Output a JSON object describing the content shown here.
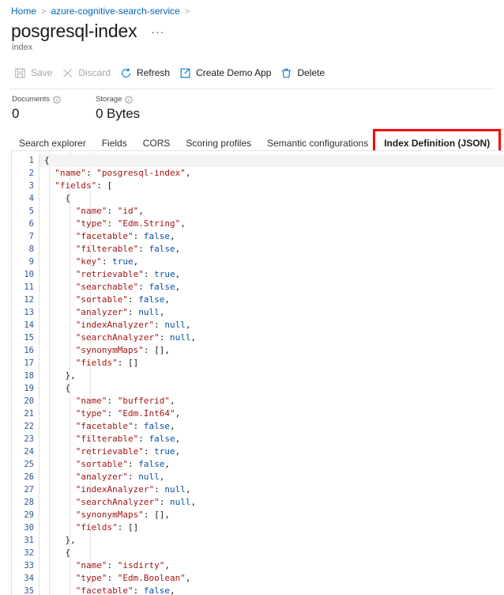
{
  "breadcrumb": {
    "items": [
      {
        "label": "Home",
        "link": true
      },
      {
        "label": "azure-cognitive-search-service",
        "link": true
      }
    ],
    "separator": ">"
  },
  "header": {
    "title": "posgresql-index",
    "ellipsis_label": "···",
    "subtitle": "index"
  },
  "toolbar": {
    "buttons": [
      {
        "label": "Save",
        "icon": "save-icon",
        "disabled": true
      },
      {
        "label": "Discard",
        "icon": "discard-icon",
        "disabled": true
      },
      {
        "label": "Refresh",
        "icon": "refresh-icon",
        "disabled": false
      },
      {
        "label": "Create Demo App",
        "icon": "open-in-new-icon",
        "disabled": false
      },
      {
        "label": "Delete",
        "icon": "trash-icon",
        "disabled": false
      }
    ]
  },
  "metrics": [
    {
      "label": "Documents",
      "value": "0",
      "icon": "info-icon"
    },
    {
      "label": "Storage",
      "value": "0 Bytes",
      "icon": "info-icon"
    }
  ],
  "tabs": {
    "items": [
      {
        "label": "Search explorer",
        "active": false
      },
      {
        "label": "Fields",
        "active": false
      },
      {
        "label": "CORS",
        "active": false
      },
      {
        "label": "Scoring profiles",
        "active": false
      },
      {
        "label": "Semantic configurations",
        "active": false
      },
      {
        "label": "Index Definition (JSON)",
        "active": true
      }
    ],
    "annotation_color": "#ff0000"
  },
  "editor": {
    "language": "json",
    "lines": [
      {
        "n": "1",
        "tokens": [
          {
            "t": "{",
            "c": "p"
          }
        ]
      },
      {
        "n": "2",
        "tokens": [
          {
            "t": "  \"name\"",
            "c": "k"
          },
          {
            "t": ": ",
            "c": "p"
          },
          {
            "t": "\"posgresql-index\"",
            "c": "s"
          },
          {
            "t": ",",
            "c": "p"
          }
        ]
      },
      {
        "n": "3",
        "tokens": [
          {
            "t": "  \"fields\"",
            "c": "k"
          },
          {
            "t": ": [",
            "c": "p"
          }
        ]
      },
      {
        "n": "4",
        "tokens": [
          {
            "t": "    {",
            "c": "p"
          }
        ]
      },
      {
        "n": "5",
        "tokens": [
          {
            "t": "      \"name\"",
            "c": "k"
          },
          {
            "t": ": ",
            "c": "p"
          },
          {
            "t": "\"id\"",
            "c": "s"
          },
          {
            "t": ",",
            "c": "p"
          }
        ]
      },
      {
        "n": "6",
        "tokens": [
          {
            "t": "      \"type\"",
            "c": "k"
          },
          {
            "t": ": ",
            "c": "p"
          },
          {
            "t": "\"Edm.String\"",
            "c": "s"
          },
          {
            "t": ",",
            "c": "p"
          }
        ]
      },
      {
        "n": "7",
        "tokens": [
          {
            "t": "      \"facetable\"",
            "c": "k"
          },
          {
            "t": ": ",
            "c": "p"
          },
          {
            "t": "false",
            "c": "b"
          },
          {
            "t": ",",
            "c": "p"
          }
        ]
      },
      {
        "n": "8",
        "tokens": [
          {
            "t": "      \"filterable\"",
            "c": "k"
          },
          {
            "t": ": ",
            "c": "p"
          },
          {
            "t": "false",
            "c": "b"
          },
          {
            "t": ",",
            "c": "p"
          }
        ]
      },
      {
        "n": "9",
        "tokens": [
          {
            "t": "      \"key\"",
            "c": "k"
          },
          {
            "t": ": ",
            "c": "p"
          },
          {
            "t": "true",
            "c": "b"
          },
          {
            "t": ",",
            "c": "p"
          }
        ]
      },
      {
        "n": "10",
        "tokens": [
          {
            "t": "      \"retrievable\"",
            "c": "k"
          },
          {
            "t": ": ",
            "c": "p"
          },
          {
            "t": "true",
            "c": "b"
          },
          {
            "t": ",",
            "c": "p"
          }
        ]
      },
      {
        "n": "11",
        "tokens": [
          {
            "t": "      \"searchable\"",
            "c": "k"
          },
          {
            "t": ": ",
            "c": "p"
          },
          {
            "t": "false",
            "c": "b"
          },
          {
            "t": ",",
            "c": "p"
          }
        ]
      },
      {
        "n": "12",
        "tokens": [
          {
            "t": "      \"sortable\"",
            "c": "k"
          },
          {
            "t": ": ",
            "c": "p"
          },
          {
            "t": "false",
            "c": "b"
          },
          {
            "t": ",",
            "c": "p"
          }
        ]
      },
      {
        "n": "13",
        "tokens": [
          {
            "t": "      \"analyzer\"",
            "c": "k"
          },
          {
            "t": ": ",
            "c": "p"
          },
          {
            "t": "null",
            "c": "b"
          },
          {
            "t": ",",
            "c": "p"
          }
        ]
      },
      {
        "n": "14",
        "tokens": [
          {
            "t": "      \"indexAnalyzer\"",
            "c": "k"
          },
          {
            "t": ": ",
            "c": "p"
          },
          {
            "t": "null",
            "c": "b"
          },
          {
            "t": ",",
            "c": "p"
          }
        ]
      },
      {
        "n": "15",
        "tokens": [
          {
            "t": "      \"searchAnalyzer\"",
            "c": "k"
          },
          {
            "t": ": ",
            "c": "p"
          },
          {
            "t": "null",
            "c": "b"
          },
          {
            "t": ",",
            "c": "p"
          }
        ]
      },
      {
        "n": "16",
        "tokens": [
          {
            "t": "      \"synonymMaps\"",
            "c": "k"
          },
          {
            "t": ": [],",
            "c": "p"
          }
        ]
      },
      {
        "n": "17",
        "tokens": [
          {
            "t": "      \"fields\"",
            "c": "k"
          },
          {
            "t": ": []",
            "c": "p"
          }
        ]
      },
      {
        "n": "18",
        "tokens": [
          {
            "t": "    },",
            "c": "p"
          }
        ]
      },
      {
        "n": "19",
        "tokens": [
          {
            "t": "    {",
            "c": "p"
          }
        ]
      },
      {
        "n": "20",
        "tokens": [
          {
            "t": "      \"name\"",
            "c": "k"
          },
          {
            "t": ": ",
            "c": "p"
          },
          {
            "t": "\"bufferid\"",
            "c": "s"
          },
          {
            "t": ",",
            "c": "p"
          }
        ]
      },
      {
        "n": "21",
        "tokens": [
          {
            "t": "      \"type\"",
            "c": "k"
          },
          {
            "t": ": ",
            "c": "p"
          },
          {
            "t": "\"Edm.Int64\"",
            "c": "s"
          },
          {
            "t": ",",
            "c": "p"
          }
        ]
      },
      {
        "n": "22",
        "tokens": [
          {
            "t": "      \"facetable\"",
            "c": "k"
          },
          {
            "t": ": ",
            "c": "p"
          },
          {
            "t": "false",
            "c": "b"
          },
          {
            "t": ",",
            "c": "p"
          }
        ]
      },
      {
        "n": "23",
        "tokens": [
          {
            "t": "      \"filterable\"",
            "c": "k"
          },
          {
            "t": ": ",
            "c": "p"
          },
          {
            "t": "false",
            "c": "b"
          },
          {
            "t": ",",
            "c": "p"
          }
        ]
      },
      {
        "n": "24",
        "tokens": [
          {
            "t": "      \"retrievable\"",
            "c": "k"
          },
          {
            "t": ": ",
            "c": "p"
          },
          {
            "t": "true",
            "c": "b"
          },
          {
            "t": ",",
            "c": "p"
          }
        ]
      },
      {
        "n": "25",
        "tokens": [
          {
            "t": "      \"sortable\"",
            "c": "k"
          },
          {
            "t": ": ",
            "c": "p"
          },
          {
            "t": "false",
            "c": "b"
          },
          {
            "t": ",",
            "c": "p"
          }
        ]
      },
      {
        "n": "26",
        "tokens": [
          {
            "t": "      \"analyzer\"",
            "c": "k"
          },
          {
            "t": ": ",
            "c": "p"
          },
          {
            "t": "null",
            "c": "b"
          },
          {
            "t": ",",
            "c": "p"
          }
        ]
      },
      {
        "n": "27",
        "tokens": [
          {
            "t": "      \"indexAnalyzer\"",
            "c": "k"
          },
          {
            "t": ": ",
            "c": "p"
          },
          {
            "t": "null",
            "c": "b"
          },
          {
            "t": ",",
            "c": "p"
          }
        ]
      },
      {
        "n": "28",
        "tokens": [
          {
            "t": "      \"searchAnalyzer\"",
            "c": "k"
          },
          {
            "t": ": ",
            "c": "p"
          },
          {
            "t": "null",
            "c": "b"
          },
          {
            "t": ",",
            "c": "p"
          }
        ]
      },
      {
        "n": "29",
        "tokens": [
          {
            "t": "      \"synonymMaps\"",
            "c": "k"
          },
          {
            "t": ": [],",
            "c": "p"
          }
        ]
      },
      {
        "n": "30",
        "tokens": [
          {
            "t": "      \"fields\"",
            "c": "k"
          },
          {
            "t": ": []",
            "c": "p"
          }
        ]
      },
      {
        "n": "31",
        "tokens": [
          {
            "t": "    },",
            "c": "p"
          }
        ]
      },
      {
        "n": "32",
        "tokens": [
          {
            "t": "    {",
            "c": "p"
          }
        ]
      },
      {
        "n": "33",
        "tokens": [
          {
            "t": "      \"name\"",
            "c": "k"
          },
          {
            "t": ": ",
            "c": "p"
          },
          {
            "t": "\"isdirty\"",
            "c": "s"
          },
          {
            "t": ",",
            "c": "p"
          }
        ]
      },
      {
        "n": "34",
        "tokens": [
          {
            "t": "      \"type\"",
            "c": "k"
          },
          {
            "t": ": ",
            "c": "p"
          },
          {
            "t": "\"Edm.Boolean\"",
            "c": "s"
          },
          {
            "t": ",",
            "c": "p"
          }
        ]
      },
      {
        "n": "35",
        "tokens": [
          {
            "t": "      \"facetable\"",
            "c": "k"
          },
          {
            "t": ": ",
            "c": "p"
          },
          {
            "t": "false",
            "c": "b"
          },
          {
            "t": ",",
            "c": "p"
          }
        ]
      }
    ]
  },
  "colors": {
    "accent": "#0078d4",
    "link": "#0067b8",
    "annotation": "#ff0000",
    "json_key": "#a31515",
    "json_literal": "#0451a5",
    "line_number": "#2b5797"
  }
}
